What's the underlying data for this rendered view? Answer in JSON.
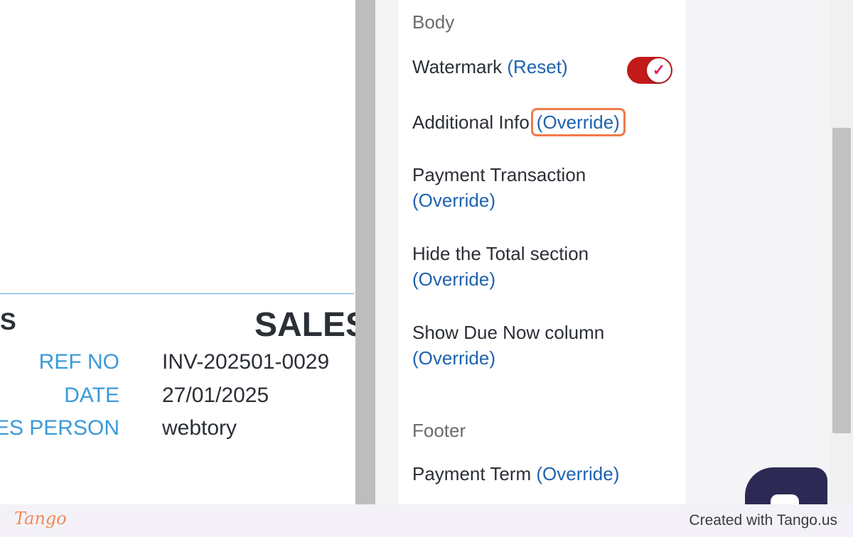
{
  "invoice_preview": {
    "heading_fragment": "S",
    "title": "SALES",
    "rows": [
      {
        "label": "REF NO",
        "value": "INV-202501-0029"
      },
      {
        "label": "DATE",
        "value": "27/01/2025"
      },
      {
        "label": "ES PERSON",
        "value": "webtory"
      }
    ]
  },
  "settings_panel": {
    "body_section_title": "Body",
    "watermark": {
      "label": "Watermark",
      "action": "(Reset)",
      "toggle_on": true
    },
    "additional_info": {
      "label": "Additional Info",
      "action": "(Override)"
    },
    "payment_transaction": {
      "label": "Payment Transaction",
      "action": "(Override)"
    },
    "hide_total": {
      "label": "Hide the Total section",
      "action": "(Override)"
    },
    "show_due_now": {
      "label": "Show Due Now column",
      "action": "(Override)"
    },
    "footer_section_title": "Footer",
    "payment_term": {
      "label": "Payment Term",
      "action": "(Override)"
    }
  },
  "footer_bar": {
    "logo": "Tango",
    "credit": "Created with Tango.us"
  },
  "colors": {
    "link": "#1e62b0",
    "toggle_on": "#c21a1a",
    "highlight": "#ef7b4a",
    "invoice_label": "#3a9ad9"
  }
}
